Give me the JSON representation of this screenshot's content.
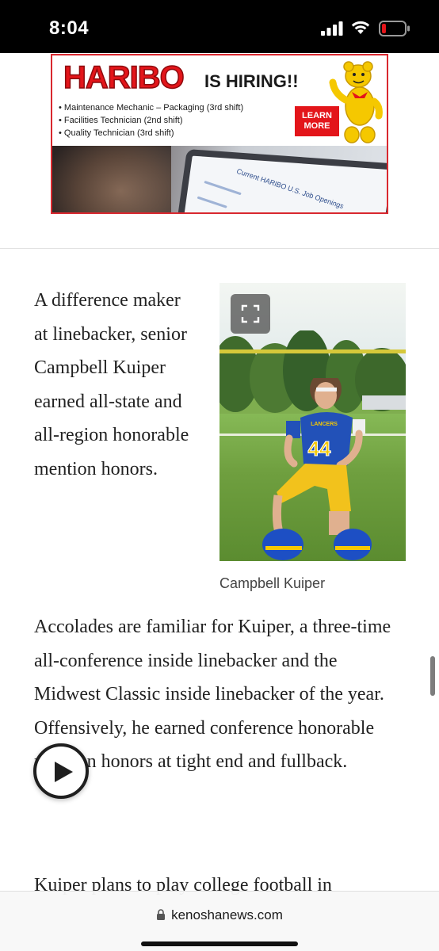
{
  "status_bar": {
    "time": "8:04",
    "icons": [
      "cellular-signal-icon",
      "wifi-icon",
      "battery-low-icon"
    ],
    "battery_color": "#e3151a"
  },
  "ad": {
    "brand": "HARIBO",
    "headline": "IS HIRING!!",
    "jobs": [
      "Maintenance Mechanic – Packaging (3rd shift)",
      "Facilities Technician (2nd shift)",
      "Quality Technician (3rd shift)"
    ],
    "cta_line1": "LEARN",
    "cta_line2": "MORE",
    "screen_text": "Current HARIBO U.S. Job Openings",
    "brand_color": "#e3151a"
  },
  "article": {
    "paragraph1": "A difference maker at linebacker, senior Campbell Kuiper earned all-state and all-region honorable mention honors.",
    "paragraph2": "Accolades are familiar for Kuiper, a three-time all-conference inside linebacker and the Midwest Classic inside linebacker of the year. Offensively, he earned conference honorable mention honors at tight end and fullback.",
    "paragraph3": "Kuiper plans to play college football in"
  },
  "figure": {
    "caption": "Campbell Kuiper",
    "jersey_number": "44",
    "jersey_text": "LANCERS",
    "expand_icon": "expand-icon"
  },
  "media": {
    "play_icon": "play-icon"
  },
  "browser": {
    "url": "kenoshanews.com",
    "lock_icon": "lock-icon"
  }
}
